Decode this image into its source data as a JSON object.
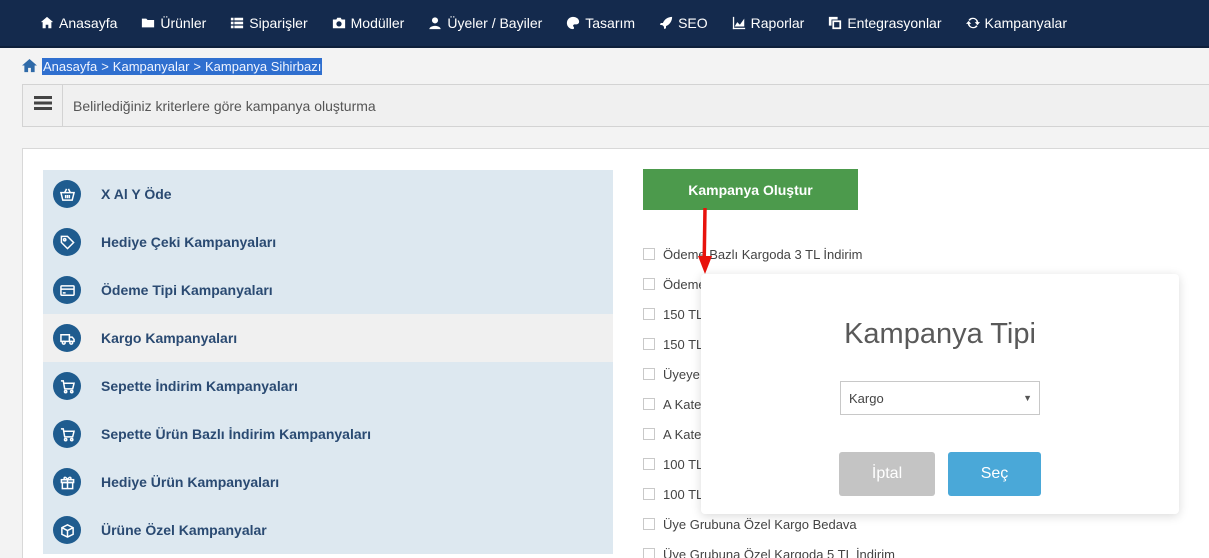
{
  "nav": {
    "items": [
      {
        "label": "Anasayfa",
        "icon": "home-icon"
      },
      {
        "label": "Ürünler",
        "icon": "folder-icon"
      },
      {
        "label": "Siparişler",
        "icon": "list-icon"
      },
      {
        "label": "Modüller",
        "icon": "camera-icon"
      },
      {
        "label": "Üyeler / Bayiler",
        "icon": "user-icon"
      },
      {
        "label": "Tasarım",
        "icon": "palette-icon"
      },
      {
        "label": "SEO",
        "icon": "rocket-icon"
      },
      {
        "label": "Raporlar",
        "icon": "chart-icon"
      },
      {
        "label": "Entegrasyonlar",
        "icon": "clone-icon"
      },
      {
        "label": "Kampanyalar",
        "icon": "refresh-icon"
      }
    ]
  },
  "breadcrumb": {
    "items": [
      "Anasayfa",
      "Kampanyalar",
      "Kampanya Sihirbazı"
    ],
    "separator": ">"
  },
  "description": {
    "text": "Belirlediğiniz kriterlere göre kampanya oluşturma"
  },
  "campaign_types": {
    "items": [
      {
        "label": "X Al Y Öde",
        "icon": "basket-icon"
      },
      {
        "label": "Hediye Çeki Kampanyaları",
        "icon": "tag-icon"
      },
      {
        "label": "Ödeme Tipi Kampanyaları",
        "icon": "credit-card-icon"
      },
      {
        "label": "Kargo Kampanyaları",
        "icon": "truck-icon"
      },
      {
        "label": "Sepette İndirim Kampanyaları",
        "icon": "cart-icon"
      },
      {
        "label": "Sepette Ürün Bazlı İndirim Kampanyaları",
        "icon": "cart-icon"
      },
      {
        "label": "Hediye Ürün Kampanyaları",
        "icon": "gift-icon"
      },
      {
        "label": "Ürüne Özel Kampanyalar",
        "icon": "box-icon"
      }
    ],
    "active_index": 3
  },
  "create_button": {
    "label": "Kampanya Oluştur"
  },
  "options": {
    "items": [
      "Ödeme Bazlı Kargoda 3 TL İndirim",
      "Ödeme",
      "150 TL",
      "150 TL",
      "Üyeye",
      "A Kate",
      "A Kate",
      "100 TL",
      "100 TL",
      "Üye Grubuna Özel Kargo Bedava",
      "Üye Grubuna Özel Kargoda 5 TL İndirim"
    ]
  },
  "modal": {
    "title": "Kampanya Tipi",
    "select_value": "Kargo",
    "cancel_label": "İptal",
    "ok_label": "Seç"
  },
  "colors": {
    "nav_bg": "#142a4d",
    "create_btn": "#4c9a4c",
    "ok_btn": "#4aa8d8",
    "cancel_btn": "#c4c4c4",
    "arrow": "#e8120c"
  }
}
